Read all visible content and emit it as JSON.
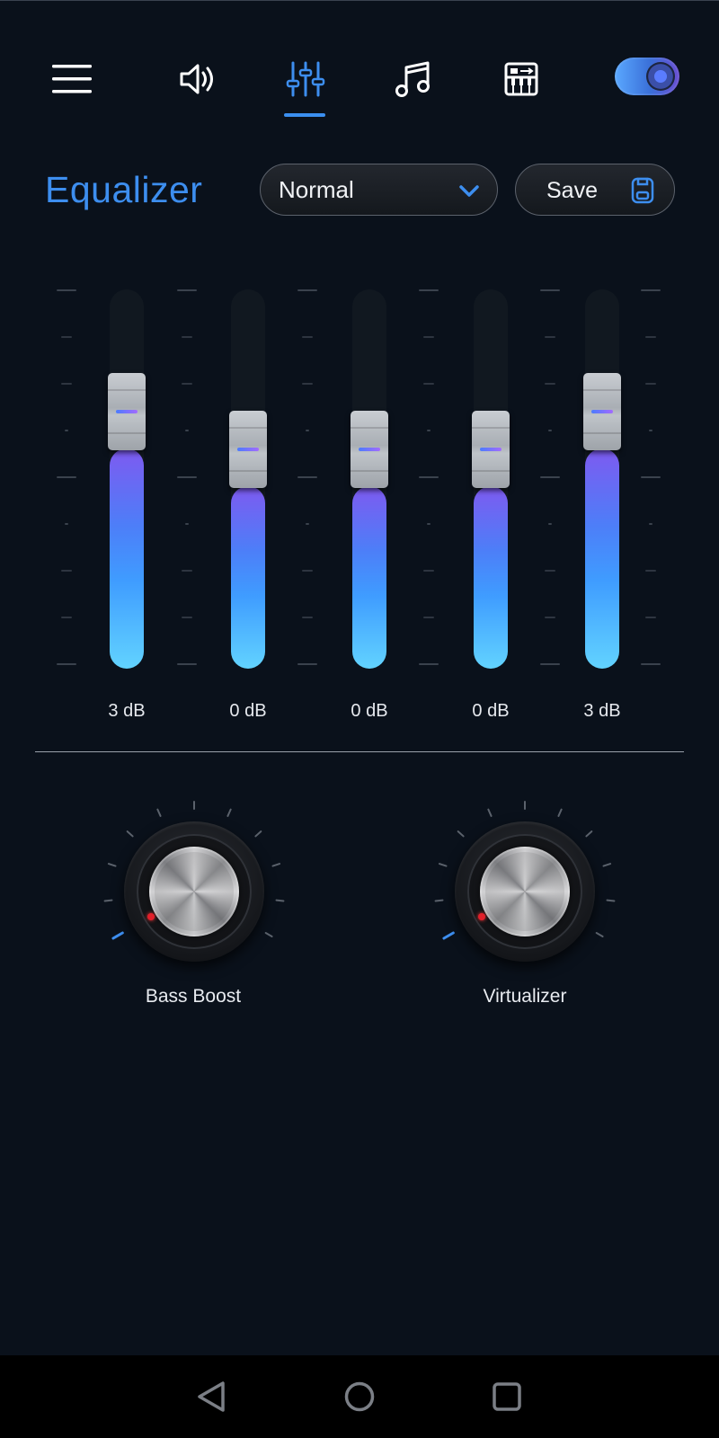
{
  "nav": {
    "menu_icon": "hamburger-menu-icon",
    "items": [
      {
        "name": "volume",
        "icon": "speaker-volume-icon",
        "active": false
      },
      {
        "name": "equalizer",
        "icon": "sliders-icon",
        "active": true
      },
      {
        "name": "music",
        "icon": "music-note-icon",
        "active": false
      },
      {
        "name": "keyboard",
        "icon": "piano-keyboard-icon",
        "active": false
      }
    ],
    "toggle_on": true
  },
  "header": {
    "title": "Equalizer",
    "preset": "Normal",
    "save_label": "Save"
  },
  "bands": [
    {
      "value_label": "3 dB",
      "level": 0.58
    },
    {
      "value_label": "0 dB",
      "level": 0.48
    },
    {
      "value_label": "0 dB",
      "level": 0.48
    },
    {
      "value_label": "0 dB",
      "level": 0.48
    },
    {
      "value_label": "3 dB",
      "level": 0.58
    }
  ],
  "knobs": [
    {
      "label": "Bass Boost",
      "level": 0
    },
    {
      "label": "Virtualizer",
      "level": 0
    }
  ],
  "colors": {
    "accent": "#3d8eef",
    "background": "#0a111b"
  },
  "system_nav": [
    "back-icon",
    "home-icon",
    "recents-icon"
  ]
}
